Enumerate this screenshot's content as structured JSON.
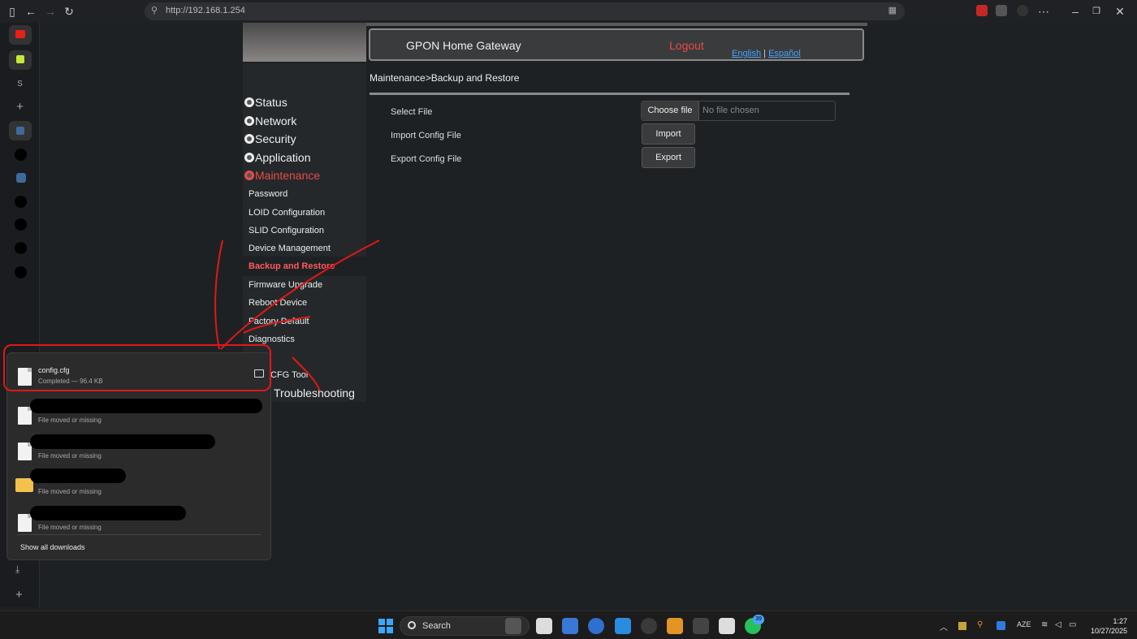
{
  "browser": {
    "url": "http://192.168.1.254"
  },
  "header": {
    "title": "GPON Home Gateway",
    "logout": "Logout",
    "lang_en": "English",
    "lang_sep": "|",
    "lang_es": "Español"
  },
  "nav": {
    "main": [
      "Status",
      "Network",
      "Security",
      "Application",
      "Maintenance"
    ],
    "sub": [
      "Password",
      "LOID Configuration",
      "SLID Configuration",
      "Device Management",
      "Backup and Restore",
      "Firmware Upgrade",
      "Reboot Device",
      "Factory Default",
      "Diagnostics"
    ],
    "cfg_tool": "CFG Tool",
    "troubleshooting": "Troubleshooting"
  },
  "main": {
    "breadcrumb": "Maintenance>Backup and Restore",
    "select_file_label": "Select File",
    "choose_file": "Choose file",
    "no_file": "No file chosen",
    "import_label": "Import Config File",
    "import_btn": "Import",
    "export_label": "Export Config File",
    "export_btn": "Export"
  },
  "downloads": {
    "items": [
      {
        "name": "config.cfg",
        "status": "Completed — 96.4 KB"
      },
      {
        "name": "",
        "status": "File moved or missing"
      },
      {
        "name": "",
        "status": "File moved or missing"
      },
      {
        "name": "",
        "status": "File moved or missing"
      },
      {
        "name": "",
        "status": "File moved or missing"
      }
    ],
    "show_all": "Show all downloads"
  },
  "sidebar": {
    "letter": "S"
  },
  "taskbar": {
    "search": "Search",
    "badge": "39",
    "lang": "AZE",
    "time": "1:27",
    "date": "10/27/2025"
  },
  "colors": {
    "accent_red": "#e84a4a",
    "link_blue": "#4aa3ff",
    "annotation_red": "#e01818"
  }
}
